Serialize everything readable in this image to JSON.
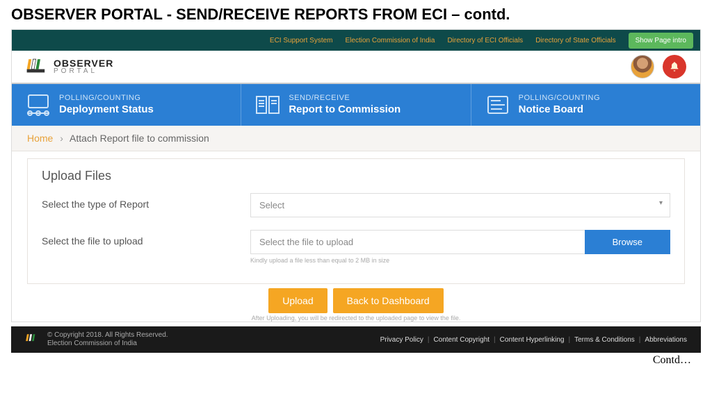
{
  "slide_title": "OBSERVER PORTAL - SEND/RECEIVE REPORTS FROM ECI – contd.",
  "topbar": {
    "links": [
      "ECI Support System",
      "Election Commission of India",
      "Directory of ECI Officials",
      "Directory of State Officials"
    ],
    "intro_button": "Show Page intro"
  },
  "logo": {
    "line1": "OBSERVER",
    "line2": "PORTAL"
  },
  "nav": [
    {
      "l1": "POLLING/COUNTING",
      "l2": "Deployment Status"
    },
    {
      "l1": "SEND/RECEIVE",
      "l2": "Report to Commission"
    },
    {
      "l1": "POLLING/COUNTING",
      "l2": "Notice Board"
    }
  ],
  "breadcrumb": {
    "home": "Home",
    "current": "Attach Report file to commission"
  },
  "panel": {
    "title": "Upload Files",
    "label_type": "Select the type of Report",
    "select_placeholder": "Select",
    "label_file": "Select the file to upload",
    "file_placeholder": "Select the file to upload",
    "browse": "Browse",
    "hint": "Kindly upload a file less than equal to 2 MB in size",
    "upload_btn": "Upload",
    "back_btn": "Back to Dashboard",
    "after_hint": "After Uploading, you will be redirected to the uploaded page to view the file."
  },
  "contd": "Contd…",
  "footer": {
    "copy1": "© Copyright 2018. All Rights Reserved.",
    "copy2": "Election Commission of India",
    "links": [
      "Privacy Policy",
      "Content Copyright",
      "Content Hyperlinking",
      "Terms & Conditions",
      "Abbreviations"
    ]
  }
}
